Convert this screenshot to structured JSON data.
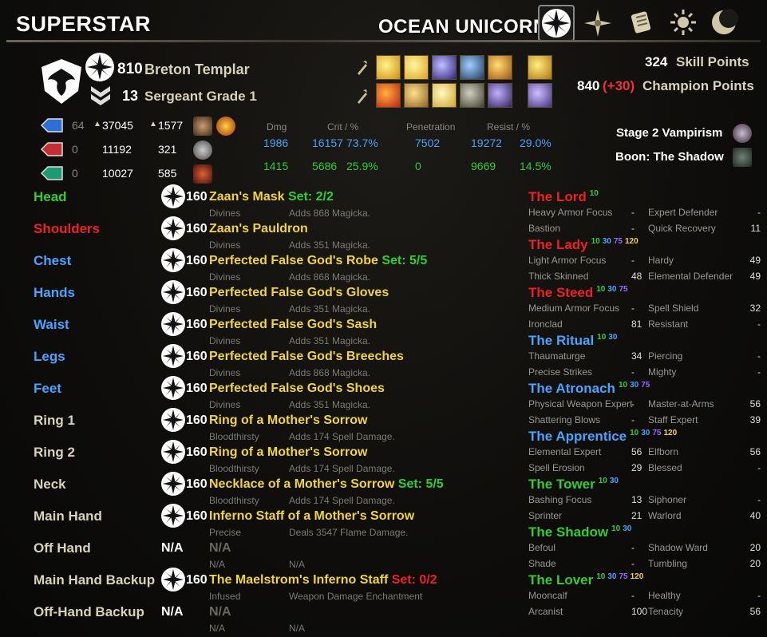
{
  "character_name": "SUPERSTAR",
  "account_name": "OCEAN UNICORN",
  "header_icons": [
    "champion-icon",
    "compass-icon",
    "scroll-icon",
    "sun-icon",
    "moon-icon"
  ],
  "profile": {
    "level": "810",
    "race_class": "Breton Templar",
    "rank_number": "13",
    "rank_title": "Sergeant Grade 1"
  },
  "points": {
    "skill_value": "324",
    "skill_label": "Skill Points",
    "champion_value": "840",
    "champion_bonus": "(+30)",
    "champion_label": "Champion Points"
  },
  "resources": [
    {
      "color": "#2e6fd6",
      "base": "64",
      "max": "37045",
      "regen": "1577"
    },
    {
      "color": "#c33030",
      "base": "0",
      "max": "11192",
      "regen": "321"
    },
    {
      "color": "#1d9a72",
      "base": "0",
      "max": "10027",
      "regen": "585"
    }
  ],
  "stats": {
    "headers": [
      "Dmg",
      "Crit / %",
      "Penetration",
      "Resist / %"
    ],
    "row1": [
      "1986",
      "16157",
      "73.7%",
      "7502",
      "19272",
      "29.0%"
    ],
    "row2": [
      "1415",
      "5686",
      "25.9%",
      "0",
      "9669",
      "14.5%"
    ]
  },
  "status": {
    "vampirism": "Stage 2 Vampirism",
    "boon": "Boon: The Shadow"
  },
  "gear": [
    {
      "slot": "Head",
      "color": "#33cc33",
      "cp": "160",
      "item": "Zaan's Mask",
      "set": "Set: 2/2",
      "setc": "g",
      "trait": "Divines",
      "ench": "Adds 868 Magicka."
    },
    {
      "slot": "Shoulders",
      "color": "#ee2222",
      "cp": "160",
      "item": "Zaan's Pauldron",
      "set": "",
      "setc": "",
      "trait": "Divines",
      "ench": "Adds 351 Magicka."
    },
    {
      "slot": "Chest",
      "color": "#4aa3ff",
      "cp": "160",
      "item": "Perfected False God's Robe",
      "set": "Set: 5/5",
      "setc": "g",
      "trait": "Divines",
      "ench": "Adds 868 Magicka."
    },
    {
      "slot": "Hands",
      "color": "#4aa3ff",
      "cp": "160",
      "item": "Perfected False God's Gloves",
      "set": "",
      "setc": "",
      "trait": "Divines",
      "ench": "Adds 351 Magicka."
    },
    {
      "slot": "Waist",
      "color": "#4aa3ff",
      "cp": "160",
      "item": "Perfected False God's Sash",
      "set": "",
      "setc": "",
      "trait": "Divines",
      "ench": "Adds 351 Magicka."
    },
    {
      "slot": "Legs",
      "color": "#4aa3ff",
      "cp": "160",
      "item": "Perfected False God's Breeches",
      "set": "",
      "setc": "",
      "trait": "Divines",
      "ench": "Adds 868 Magicka."
    },
    {
      "slot": "Feet",
      "color": "#4aa3ff",
      "cp": "160",
      "item": "Perfected False God's Shoes",
      "set": "",
      "setc": "",
      "trait": "Divines",
      "ench": "Adds 351 Magicka."
    },
    {
      "slot": "Ring 1",
      "color": "#d8d2b8",
      "cp": "160",
      "item": "Ring of a Mother's Sorrow",
      "set": "",
      "setc": "",
      "trait": "Bloodthirsty",
      "ench": "Adds 174 Spell Damage."
    },
    {
      "slot": "Ring 2",
      "color": "#d8d2b8",
      "cp": "160",
      "item": "Ring of a Mother's Sorrow",
      "set": "",
      "setc": "",
      "trait": "Bloodthirsty",
      "ench": "Adds 174 Spell Damage."
    },
    {
      "slot": "Neck",
      "color": "#d8d2b8",
      "cp": "160",
      "item": "Necklace of a Mother's Sorrow",
      "set": "Set: 5/5",
      "setc": "g",
      "trait": "Bloodthirsty",
      "ench": "Adds 174 Spell Damage."
    },
    {
      "slot": "Main Hand",
      "color": "#d8d2b8",
      "cp": "160",
      "item": "Inferno Staff of a Mother's Sorrow",
      "set": "",
      "setc": "",
      "trait": "Precise",
      "ench": "Deals 3547 Flame Damage."
    },
    {
      "slot": "Off Hand",
      "color": "#d8d2b8",
      "cp": "N/A",
      "item": "N/A",
      "set": "",
      "setc": "na",
      "trait": "N/A",
      "ench": "N/A"
    },
    {
      "slot": "Main Hand Backup",
      "color": "#d8d2b8",
      "cp": "160",
      "item": "The Maelstrom's Inferno Staff",
      "set": "Set: 0/2",
      "setc": "r",
      "trait": "Infused",
      "ench": "Weapon Damage Enchantment"
    },
    {
      "slot": "Off-Hand Backup",
      "color": "#d8d2b8",
      "cp": "N/A",
      "item": "N/A",
      "set": "",
      "setc": "na",
      "trait": "N/A",
      "ench": "N/A"
    }
  ],
  "constellations": [
    {
      "name": "The Lord",
      "color": "#ee2222",
      "tiers": [
        [
          "10",
          "#33cc33"
        ]
      ],
      "rows": [
        [
          "Heavy Armor Focus",
          "-",
          "Expert Defender",
          "-"
        ],
        [
          "Bastion",
          "-",
          "Quick Recovery",
          "11"
        ]
      ]
    },
    {
      "name": "The Lady",
      "color": "#ee2222",
      "tiers": [
        [
          "10",
          "#33cc33"
        ],
        [
          "30",
          "#4aa3ff"
        ],
        [
          "75",
          "#9966ff"
        ],
        [
          "120",
          "#f2d43a"
        ]
      ],
      "rows": [
        [
          "Light Armor Focus",
          "-",
          "Hardy",
          "49"
        ],
        [
          "Thick Skinned",
          "48",
          "Elemental Defender",
          "49"
        ]
      ]
    },
    {
      "name": "The Steed",
      "color": "#ee2222",
      "tiers": [
        [
          "10",
          "#33cc33"
        ],
        [
          "30",
          "#4aa3ff"
        ],
        [
          "75",
          "#9966ff"
        ]
      ],
      "rows": [
        [
          "Medium Armor Focus",
          "-",
          "Spell Shield",
          "32"
        ],
        [
          "Ironclad",
          "81",
          "Resistant",
          "-"
        ]
      ]
    },
    {
      "name": "The Ritual",
      "color": "#4aa3ff",
      "tiers": [
        [
          "10",
          "#33cc33"
        ],
        [
          "30",
          "#4aa3ff"
        ]
      ],
      "rows": [
        [
          "Thaumaturge",
          "34",
          "Piercing",
          "-"
        ],
        [
          "Precise Strikes",
          "-",
          "Mighty",
          "-"
        ]
      ]
    },
    {
      "name": "The Atronach",
      "color": "#4aa3ff",
      "tiers": [
        [
          "10",
          "#33cc33"
        ],
        [
          "30",
          "#4aa3ff"
        ],
        [
          "75",
          "#9966ff"
        ]
      ],
      "rows": [
        [
          "Physical Weapon Expert",
          "-",
          "Master-at-Arms",
          "56"
        ],
        [
          "Shattering Blows",
          "-",
          "Staff Expert",
          "39"
        ]
      ]
    },
    {
      "name": "The Apprentice",
      "color": "#4aa3ff",
      "tiers": [
        [
          "10",
          "#33cc33"
        ],
        [
          "30",
          "#4aa3ff"
        ],
        [
          "75",
          "#9966ff"
        ],
        [
          "120",
          "#f2d43a"
        ]
      ],
      "rows": [
        [
          "Elemental Expert",
          "56",
          "Elfborn",
          "56"
        ],
        [
          "Spell Erosion",
          "29",
          "Blessed",
          "-"
        ]
      ]
    },
    {
      "name": "The Tower",
      "color": "#33cc33",
      "tiers": [
        [
          "10",
          "#33cc33"
        ],
        [
          "30",
          "#4aa3ff"
        ]
      ],
      "rows": [
        [
          "Bashing Focus",
          "13",
          "Siphoner",
          "-"
        ],
        [
          "Sprinter",
          "21",
          "Warlord",
          "40"
        ]
      ]
    },
    {
      "name": "The Shadow",
      "color": "#33cc33",
      "tiers": [
        [
          "10",
          "#33cc33"
        ],
        [
          "30",
          "#4aa3ff"
        ]
      ],
      "rows": [
        [
          "Befoul",
          "-",
          "Shadow Ward",
          "20"
        ],
        [
          "Shade",
          "-",
          "Tumbling",
          "20"
        ]
      ]
    },
    {
      "name": "The Lover",
      "color": "#33cc33",
      "tiers": [
        [
          "10",
          "#33cc33"
        ],
        [
          "30",
          "#4aa3ff"
        ],
        [
          "75",
          "#9966ff"
        ],
        [
          "120",
          "#f2d43a"
        ]
      ],
      "rows": [
        [
          "Mooncalf",
          "-",
          "Healthy",
          "-"
        ],
        [
          "Arcanist",
          "100",
          "Tenacity",
          "56"
        ]
      ]
    }
  ]
}
